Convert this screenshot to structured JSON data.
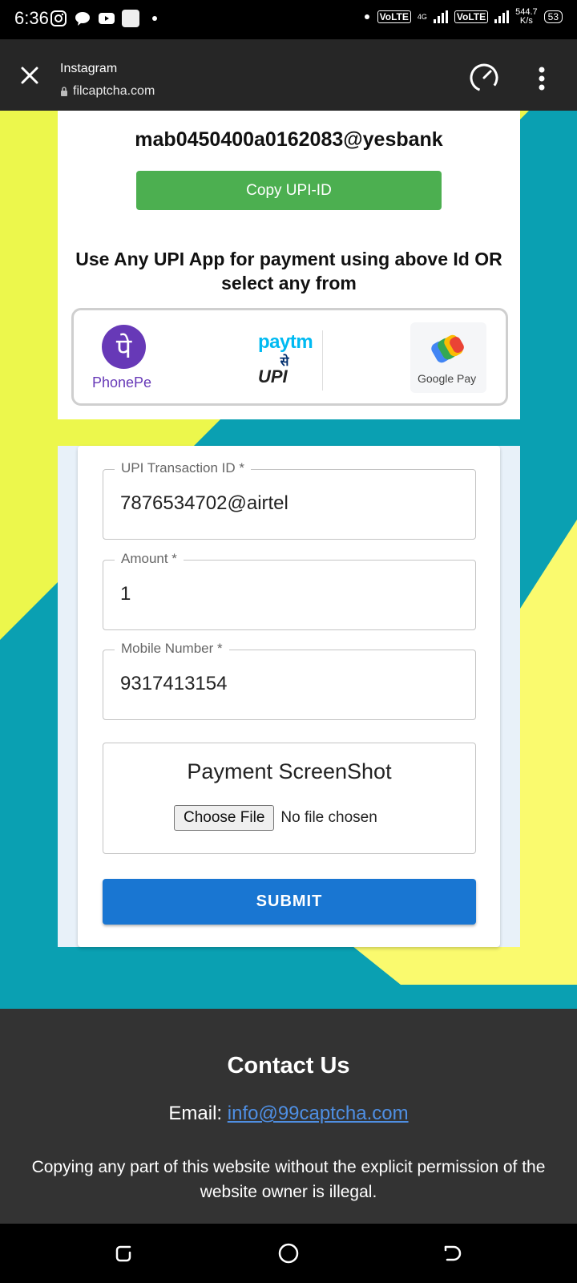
{
  "status_bar": {
    "time": "6:36",
    "speed_value": "544.7",
    "speed_unit": "K/s",
    "volte1": "VoLTE",
    "volte2": "VoLTE",
    "network": "4G",
    "battery": "53"
  },
  "browser": {
    "app_name": "Instagram",
    "url": "filcaptcha.com"
  },
  "payment": {
    "upi_id": "mab0450400a0162083@yesbank",
    "copy_label": "Copy UPI-ID",
    "instruction": "Use Any UPI App for payment using above Id OR select any from",
    "apps": {
      "phonepe": "PhonePe",
      "phonepe_glyph": "पे",
      "paytm": "paytm",
      "paytm_se": "से",
      "paytm_upi": "UPI",
      "gpay": "Google Pay"
    }
  },
  "form": {
    "upi_txn_label": "UPI Transaction ID *",
    "upi_txn_value": "7876534702@airtel",
    "amount_label": "Amount *",
    "amount_value": "1",
    "mobile_label": "Mobile Number *",
    "mobile_value": "9317413154",
    "screenshot_title": "Payment ScreenShot",
    "choose_file": "Choose File",
    "no_file": "No file chosen",
    "submit": "SUBMIT"
  },
  "footer": {
    "title": "Contact Us",
    "email_label": "Email: ",
    "email": "info@99captcha.com",
    "note": "Copying any part of this website without the explicit permission of the website owner is illegal."
  },
  "colors": {
    "teal": "#0aa0b2",
    "yellow_green": "#ecf74c",
    "yellow": "#fafa6e",
    "copy_green": "#4caf50",
    "submit_blue": "#1976d2",
    "phonepe_purple": "#6739b7",
    "footer_bg": "#333333"
  },
  "icons": [
    "close-icon",
    "lock-icon",
    "speedometer-icon",
    "more-vert-icon",
    "recent-apps-icon",
    "home-icon",
    "back-icon"
  ]
}
